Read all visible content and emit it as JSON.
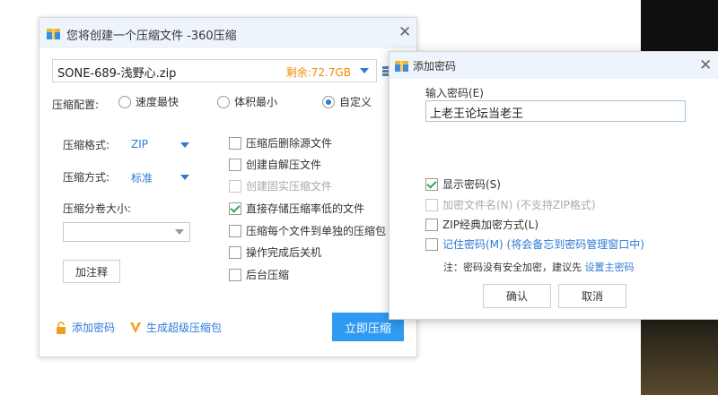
{
  "main": {
    "title": "您将创建一个压缩文件 -360压缩",
    "file_name": "SONE-689-浅野心.zip",
    "free_space": "剩余:72.7GB",
    "config_label": "压缩配置:",
    "radios": [
      {
        "label": "速度最快",
        "selected": false
      },
      {
        "label": "体积最小",
        "selected": false
      },
      {
        "label": "自定义",
        "selected": true
      }
    ],
    "format_label": "压缩格式:",
    "format_value": "ZIP",
    "method_label": "压缩方式:",
    "method_value": "标准",
    "split_label": "压缩分卷大小:",
    "split_value": "",
    "comment_button": "加注释",
    "options": [
      {
        "label": "压缩后删除源文件",
        "checked": false,
        "disabled": false
      },
      {
        "label": "创建自解压文件",
        "checked": false,
        "disabled": false
      },
      {
        "label": "创建固实压缩文件",
        "checked": false,
        "disabled": true
      },
      {
        "label": "直接存储压缩率低的文件",
        "checked": true,
        "disabled": false
      },
      {
        "label": "压缩每个文件到单独的压缩包",
        "checked": false,
        "disabled": false
      },
      {
        "label": "操作完成后关机",
        "checked": false,
        "disabled": false
      },
      {
        "label": "后台压缩",
        "checked": false,
        "disabled": false
      }
    ],
    "add_password_link": "添加密码",
    "super_zip_link": "生成超级压缩包",
    "compress_button": "立即压缩"
  },
  "password_dialog": {
    "title": "添加密码",
    "input_label": "输入密码(E)",
    "password_value": "上老王论坛当老王",
    "options": [
      {
        "label": "显示密码(S)",
        "checked": true,
        "disabled": false
      },
      {
        "label": "加密文件名(N) (不支持ZIP格式)",
        "checked": false,
        "disabled": true
      },
      {
        "label": "ZIP经典加密方式(L)",
        "checked": false,
        "disabled": false
      },
      {
        "label": "记住密码(M) (将会备忘到密码管理窗口中)",
        "checked": false,
        "disabled": false
      }
    ],
    "note_text": "注：密码没有安全加密，建议先",
    "note_link": "设置主密码",
    "ok_button": "确认",
    "cancel_button": "取消"
  },
  "colors": {
    "accent": "#2d7ad8",
    "primary_button": "#2f9af2",
    "free_space": "#f08c00",
    "check": "#36a852"
  }
}
